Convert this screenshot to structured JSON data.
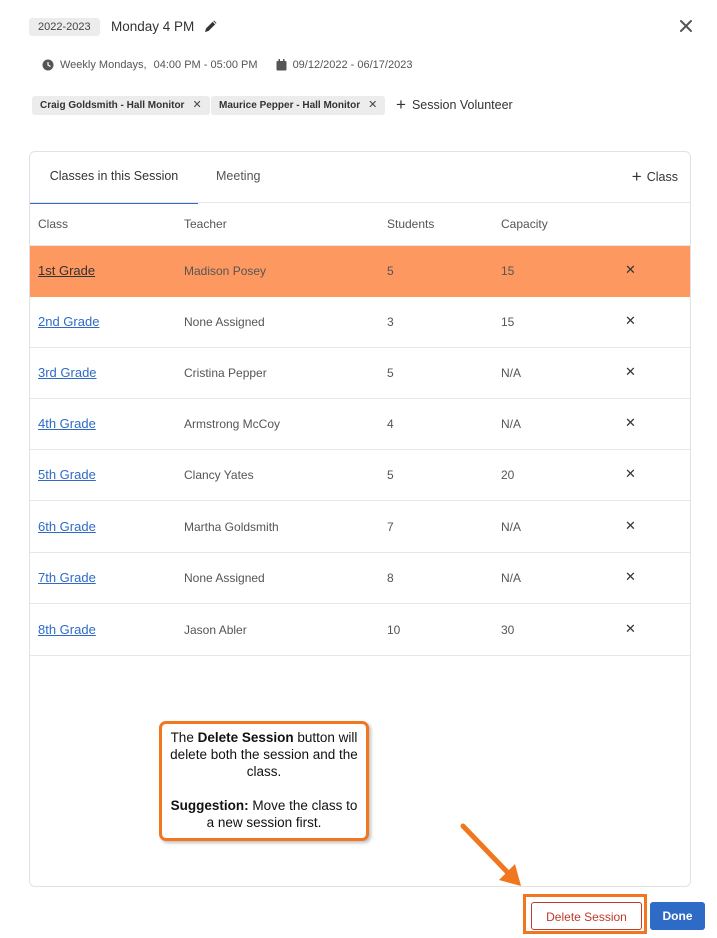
{
  "header": {
    "year_badge": "2022-2023",
    "title": "Monday 4 PM",
    "schedule_days": "Weekly Mondays,",
    "schedule_time": "04:00 PM - 05:00 PM",
    "date_range": "09/12/2022 - 06/17/2023"
  },
  "volunteers": [
    {
      "label": "Craig Goldsmith - Hall Monitor"
    },
    {
      "label": "Maurice Pepper - Hall Monitor"
    }
  ],
  "add_volunteer_label": "Session Volunteer",
  "tabs": [
    {
      "label": "Classes in this Session"
    },
    {
      "label": "Meeting"
    }
  ],
  "add_class_label": "Class",
  "table": {
    "columns": [
      "Class",
      "Teacher",
      "Students",
      "Capacity"
    ],
    "rows": [
      {
        "class": "1st Grade",
        "teacher": "Madison Posey",
        "students": "5",
        "capacity": "15"
      },
      {
        "class": "2nd Grade",
        "teacher": "None Assigned",
        "students": "3",
        "capacity": "15"
      },
      {
        "class": "3rd Grade",
        "teacher": "Cristina Pepper",
        "students": "5",
        "capacity": "N/A"
      },
      {
        "class": "4th Grade",
        "teacher": "Armstrong McCoy",
        "students": "4",
        "capacity": "N/A"
      },
      {
        "class": "5th Grade",
        "teacher": "Clancy Yates",
        "students": "5",
        "capacity": "20"
      },
      {
        "class": "6th Grade",
        "teacher": "Martha Goldsmith",
        "students": "7",
        "capacity": "N/A"
      },
      {
        "class": "7th Grade",
        "teacher": "None Assigned",
        "students": "8",
        "capacity": "N/A"
      },
      {
        "class": "8th Grade",
        "teacher": "Jason Abler",
        "students": "10",
        "capacity": "30"
      }
    ]
  },
  "callout": {
    "line1_pre": "The ",
    "line1_bold": "Delete Session",
    "line1_post": " button will delete both the session and the class.",
    "line2_bold": "Suggestion:",
    "line2_post": " Move the class to a new session first."
  },
  "footer": {
    "delete_label": "Delete Session",
    "done_label": "Done"
  },
  "colors": {
    "accent": "#2e6bc6",
    "highlight_row": "#fd9861",
    "callout_border": "#f07620",
    "delete_red": "#c0392b"
  }
}
